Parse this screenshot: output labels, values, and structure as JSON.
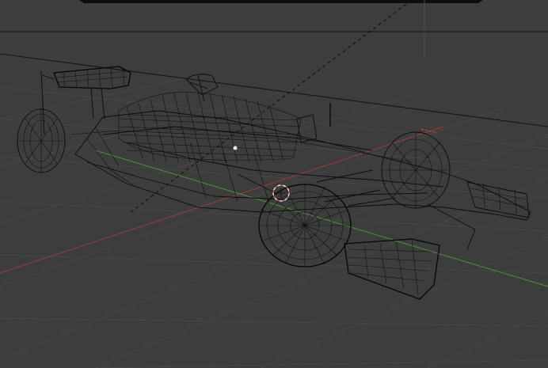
{
  "viewport": {
    "mode": "wireframe",
    "object": "formula-one-car",
    "colors": {
      "background": "#3d3d3d",
      "grid": "#474747",
      "wireframe": "#0b0b0b",
      "axis_x": "#b23a3a",
      "axis_y": "#4e9a3e",
      "cursor_red": "#e05050",
      "cursor_white": "#ffffff"
    },
    "icons": [
      "3d-cursor-icon",
      "light-object-icon",
      "camera-object-icon"
    ]
  }
}
